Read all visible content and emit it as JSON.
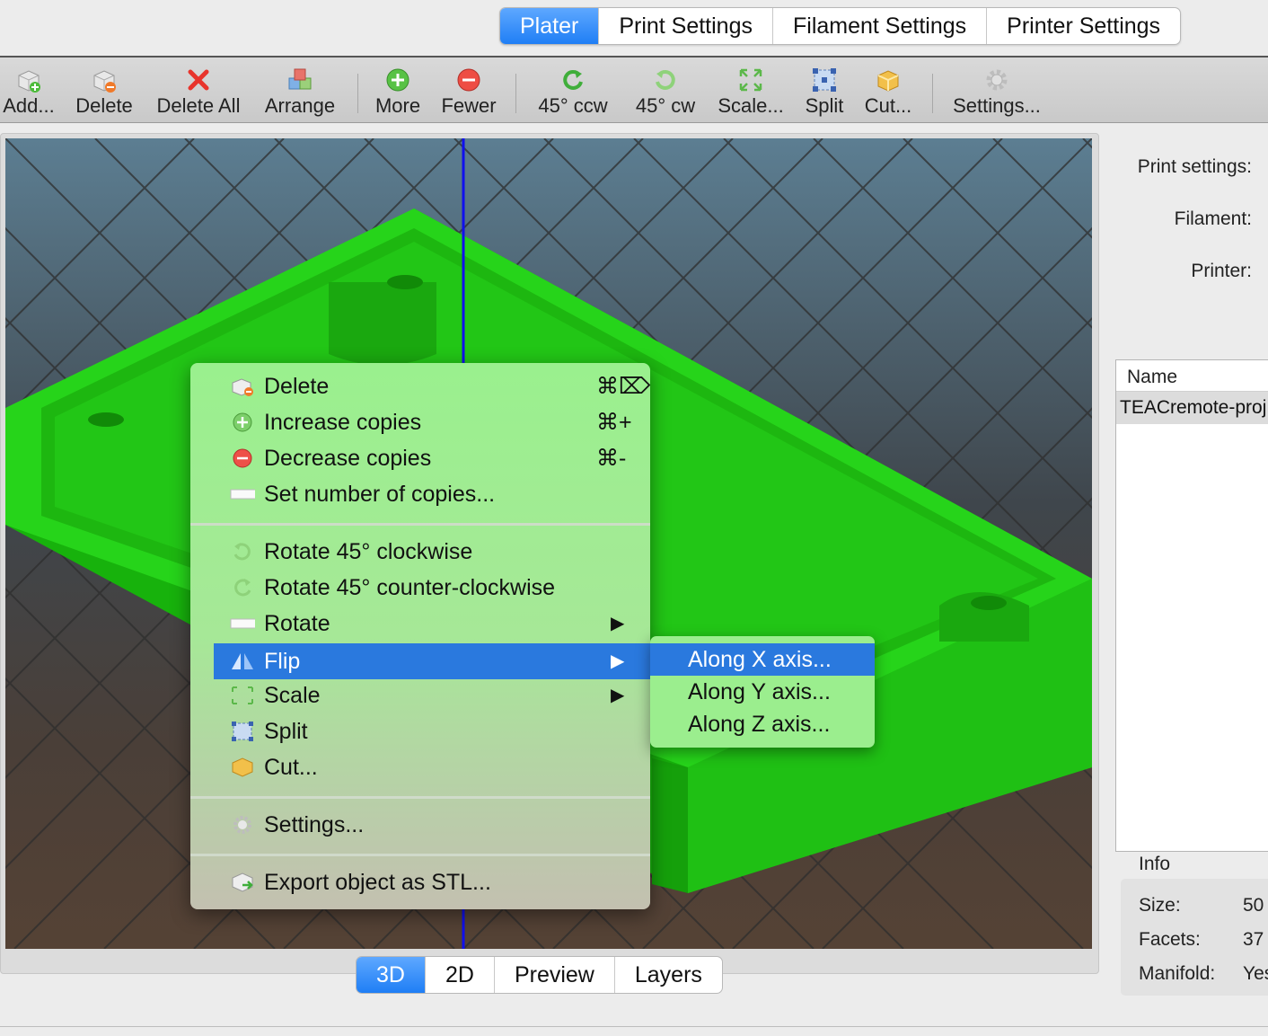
{
  "tabs": [
    "Plater",
    "Print Settings",
    "Filament Settings",
    "Printer Settings"
  ],
  "toolbar": {
    "add": "Add...",
    "delete": "Delete",
    "delete_all": "Delete All",
    "arrange": "Arrange",
    "more": "More",
    "fewer": "Fewer",
    "rotate_ccw": "45° ccw",
    "rotate_cw": "45° cw",
    "scale": "Scale...",
    "split": "Split",
    "cut": "Cut...",
    "settings": "Settings..."
  },
  "view_tabs": [
    "3D",
    "2D",
    "Preview",
    "Layers"
  ],
  "right_panel": {
    "print_settings_label": "Print settings:",
    "filament_label": "Filament:",
    "printer_label": "Printer:",
    "list_header": "Name",
    "object_name": "TEACremote-proj",
    "info_title": "Info",
    "size_label": "Size:",
    "size_value": "50",
    "facets_label": "Facets:",
    "facets_value": "37",
    "manifold_label": "Manifold:",
    "manifold_value": "Yes"
  },
  "context_menu": {
    "delete": "Delete",
    "delete_shortcut": "⌘⌦",
    "increase": "Increase copies",
    "increase_shortcut": "⌘+",
    "decrease": "Decrease copies",
    "decrease_shortcut": "⌘-",
    "set_copies": "Set number of copies...",
    "rotate_cw": "Rotate 45° clockwise",
    "rotate_ccw": "Rotate 45° counter-clockwise",
    "rotate": "Rotate",
    "flip": "Flip",
    "scale": "Scale",
    "split": "Split",
    "cut": "Cut...",
    "settings": "Settings...",
    "export": "Export object as STL..."
  },
  "flip_submenu": [
    "Along X axis...",
    "Along Y axis...",
    "Along Z axis..."
  ],
  "colors": {
    "accent": "#2a79de",
    "model_green": "#22cc11",
    "menu_green": "#9af08e"
  }
}
